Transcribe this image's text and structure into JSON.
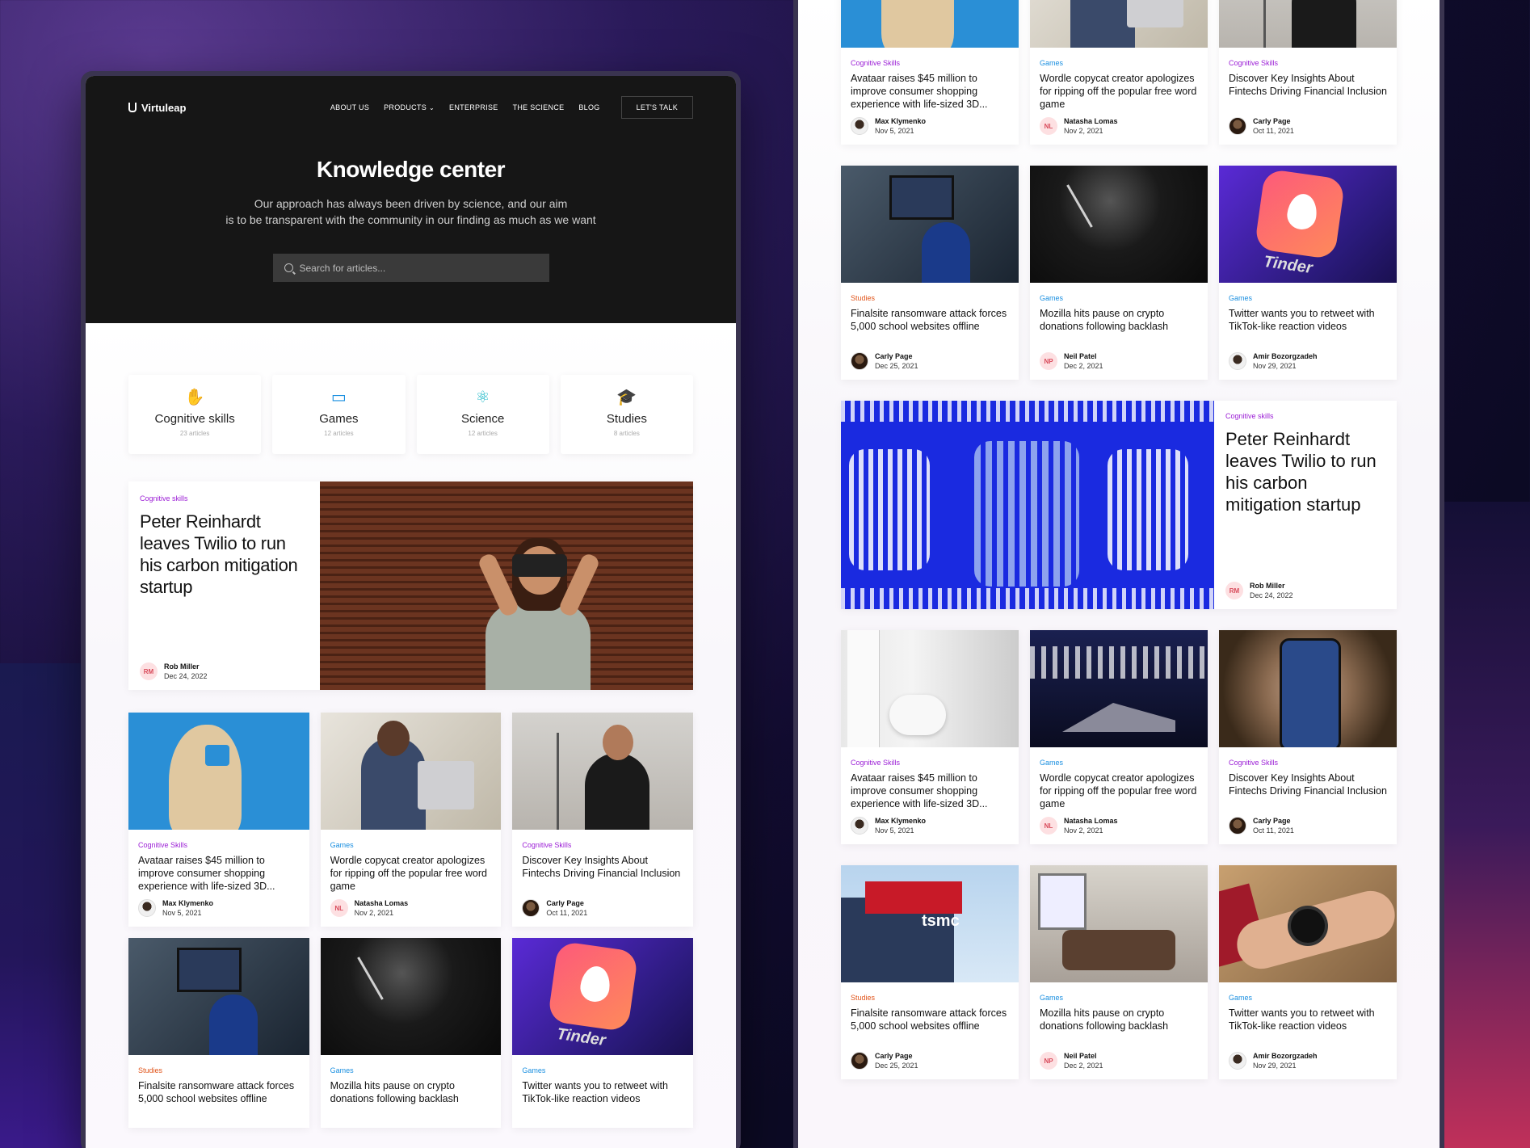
{
  "brand": {
    "name": "Virtuleap"
  },
  "nav": {
    "items": [
      "ABOUT US",
      "PRODUCTS",
      "ENTERPRISE",
      "THE SCIENCE",
      "BLOG"
    ],
    "cta": "LET'S TALK"
  },
  "hero": {
    "title": "Knowledge center",
    "subtitle_line1": "Our approach has always been driven by science, and our aim",
    "subtitle_line2": "is to be transparent with the community in our finding as much as we want",
    "search_placeholder": "Search for articles..."
  },
  "categories": [
    {
      "name": "Cognitive skills",
      "count": "23 articles",
      "icon": "hand-icon",
      "color": "#9c1fd6"
    },
    {
      "name": "Games",
      "count": "12 articles",
      "icon": "vr-headset-icon",
      "color": "#1a8fe0"
    },
    {
      "name": "Science",
      "count": "12 articles",
      "icon": "atom-icon",
      "color": "#1ab8c8"
    },
    {
      "name": "Studies",
      "count": "8 articles",
      "icon": "graduation-cap-icon",
      "color": "#e0541a"
    }
  ],
  "featured": {
    "tag": "Cognitive skills",
    "title": "Peter Reinhardt leaves Twilio to run his carbon mitigation startup",
    "author": "Rob Miller",
    "initials": "RM",
    "date": "Dec 24, 2022"
  },
  "articles": [
    {
      "tag": "Cognitive Skills",
      "title": "Avataar raises $45 million to improve consumer shopping experience with life-sized 3D...",
      "author": "Max Klymenko",
      "date": "Nov 5, 2021",
      "initials": ""
    },
    {
      "tag": "Games",
      "title": "Wordle copycat creator apologizes for ripping off the popular free word game",
      "author": "Natasha Lomas",
      "date": "Nov 2, 2021",
      "initials": "NL"
    },
    {
      "tag": "Cognitive Skills",
      "title": "Discover Key Insights About Fintechs Driving Financial Inclusion",
      "author": "Carly Page",
      "date": "Oct 11, 2021",
      "initials": ""
    },
    {
      "tag": "Studies",
      "title": "Finalsite ransomware attack forces 5,000 school websites offline",
      "author": "Carly Page",
      "date": "Dec 25, 2021",
      "initials": ""
    },
    {
      "tag": "Games",
      "title": "Mozilla hits pause on crypto donations following backlash",
      "author": "Neil Patel",
      "date": "Dec 2, 2021",
      "initials": "NP"
    },
    {
      "tag": "Games",
      "title": "Twitter wants you to retweet with TikTok-like reaction videos",
      "author": "Amir Bozorgzadeh",
      "date": "Nov 29, 2021",
      "initials": ""
    }
  ],
  "thumbs": {
    "tinder_word": "Tinder",
    "tsmc_word": "tsmc"
  }
}
